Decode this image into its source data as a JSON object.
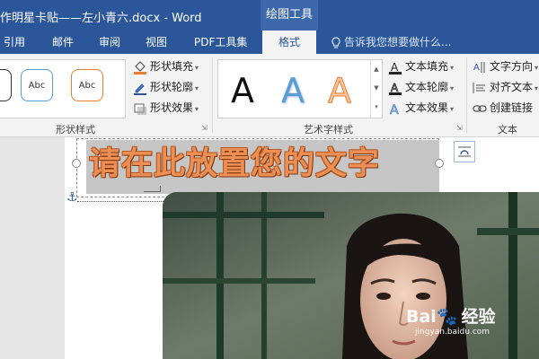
{
  "window": {
    "title": "作明星卡贴——左小青六.docx - Word"
  },
  "context_tab_group": "绘图工具",
  "tabs": [
    {
      "label": "引用",
      "active": false
    },
    {
      "label": "邮件",
      "active": false
    },
    {
      "label": "审阅",
      "active": false
    },
    {
      "label": "视图",
      "active": false
    },
    {
      "label": "PDF工具集",
      "active": false
    },
    {
      "label": "格式",
      "active": true
    }
  ],
  "tell_me": {
    "placeholder": "告诉我您想要做什么...",
    "icon": "lightbulb-icon"
  },
  "ribbon": {
    "shape_styles": {
      "label": "形状样式",
      "swatches": [
        {
          "text": "",
          "border": "#333333"
        },
        {
          "text": "Abc",
          "border": "#5b9bd5"
        },
        {
          "text": "Abc",
          "border": "#ed7d31"
        }
      ],
      "commands": [
        {
          "label": "形状填充",
          "icon": "paint-bucket-icon",
          "color": "#ed7d31"
        },
        {
          "label": "形状轮廓",
          "icon": "pencil-icon",
          "color": "#2f5597"
        },
        {
          "label": "形状效果",
          "icon": "shape-effects-icon",
          "color": "#666666"
        }
      ]
    },
    "wordart_styles": {
      "label": "艺术字样式",
      "samples": [
        {
          "text": "A",
          "style": "black"
        },
        {
          "text": "A",
          "style": "blue-gradient"
        },
        {
          "text": "A",
          "style": "orange-outline"
        }
      ],
      "commands": [
        {
          "label": "文本填充",
          "icon": "text-fill-icon"
        },
        {
          "label": "文本轮廓",
          "icon": "text-outline-icon"
        },
        {
          "label": "文本效果",
          "icon": "text-effects-icon"
        }
      ]
    },
    "text": {
      "label": "文本",
      "commands": [
        {
          "label": "文字方向",
          "icon": "text-direction-icon"
        },
        {
          "label": "对齐文本",
          "icon": "align-text-icon"
        },
        {
          "label": "创建链接",
          "icon": "link-icon"
        }
      ]
    }
  },
  "document": {
    "wordart_text": "请在此放置您的文字",
    "layout_options_icon": "layout-options-icon",
    "anchor_icon": "anchor-icon"
  },
  "watermark": {
    "brand": "Bai",
    "suffix": "经验",
    "url": "jingyan.baidu.com"
  },
  "colors": {
    "word_blue": "#2b579a",
    "wordart_orange": "#ec8f55"
  }
}
